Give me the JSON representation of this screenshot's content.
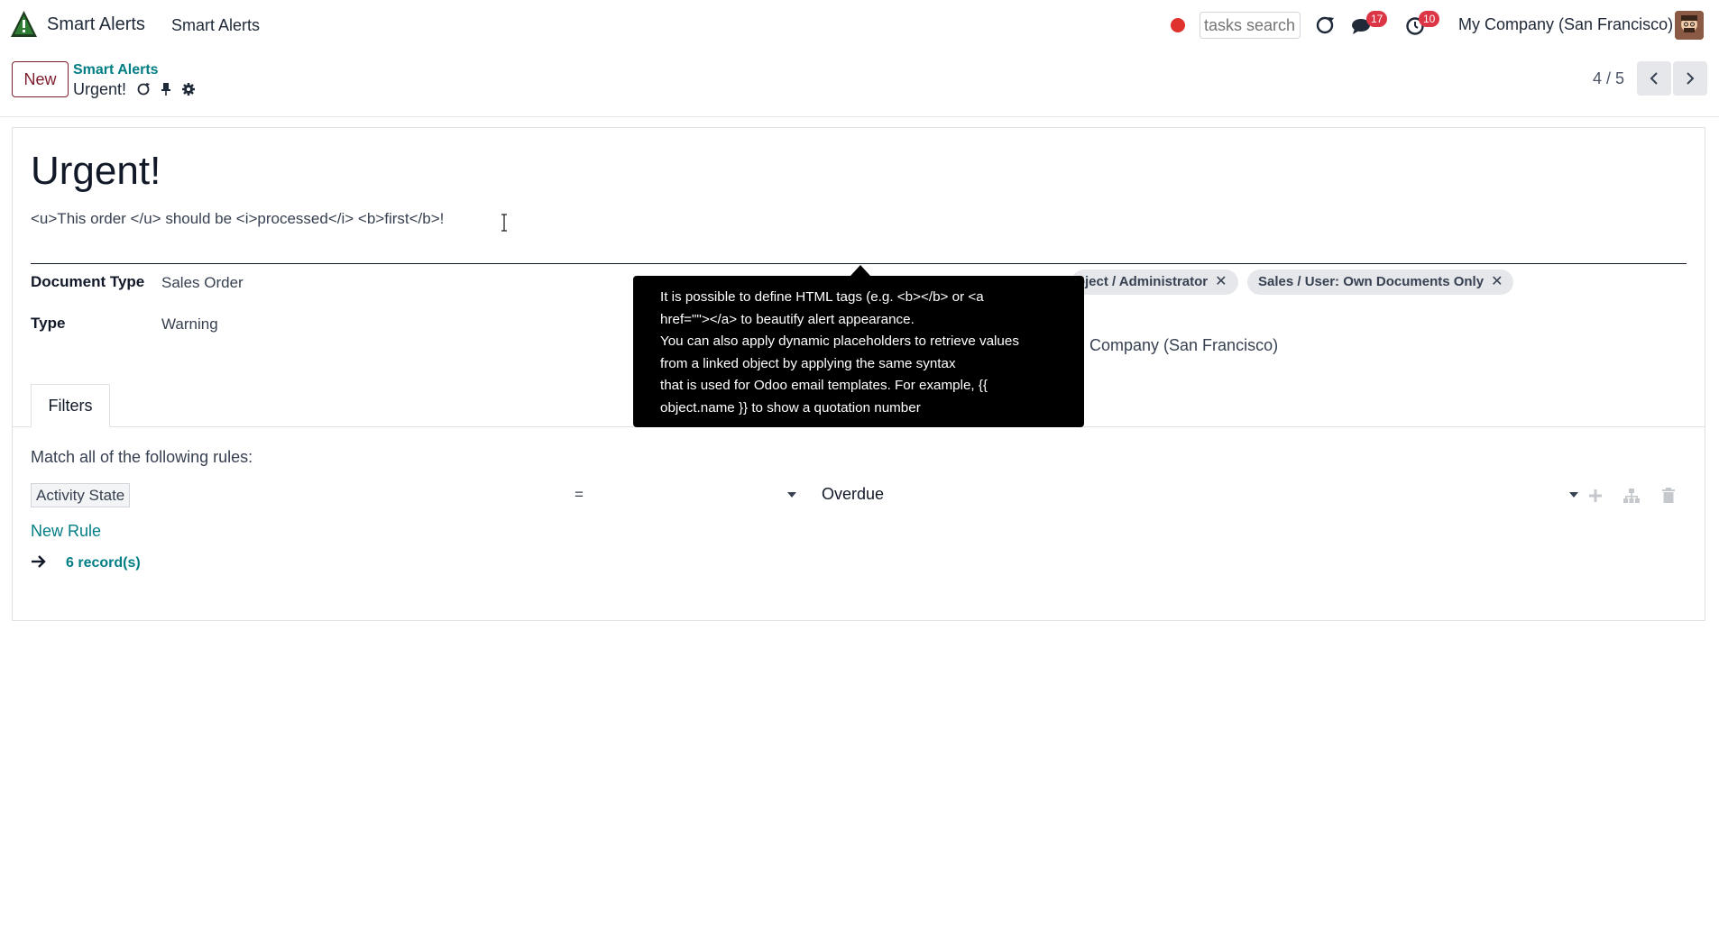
{
  "navbar": {
    "app_name": "Smart Alerts",
    "menu_item": "Smart Alerts",
    "search_placeholder": "tasks search",
    "messages_badge": "17",
    "activities_badge": "10",
    "company": "My Company (San Francisco)"
  },
  "control_panel": {
    "new_label": "New",
    "breadcrumb_parent": "Smart Alerts",
    "breadcrumb_current": "Urgent!",
    "pager_value": "4 / 5"
  },
  "form": {
    "title": "Urgent!",
    "message": "<u>This order </u> should be <i>processed</i> <b>first</b>!",
    "document_type_label": "Document Type",
    "document_type_value": "Sales Order",
    "type_label": "Type",
    "type_value": "Warning",
    "groups": [
      "roject / Administrator",
      "Sales / User: Own Documents Only"
    ],
    "company_value": "Company (San Francisco)"
  },
  "tabs": {
    "filters_label": "Filters"
  },
  "filters": {
    "match_text": "Match all of the following rules:",
    "rule_field": "Activity State",
    "rule_operator": "=",
    "rule_value": "Overdue",
    "new_rule_label": "New Rule",
    "records_label": "6 record(s)"
  },
  "tooltip": {
    "lines": [
      "It is possible to define HTML tags (e.g. <b></b> or <a",
      "href=\"\"></a> to beautify alert appearance.",
      "You can also apply dynamic placeholders to retrieve values",
      "from a linked object by applying the same syntax",
      "that is used for Odoo email templates. For example, {{",
      "object.name }} to show a quotation number"
    ]
  },
  "colors": {
    "accent": "#017e84",
    "primary": "#7c1c2c",
    "badge": "#dc3545",
    "tooltip_bg": "#000000"
  }
}
